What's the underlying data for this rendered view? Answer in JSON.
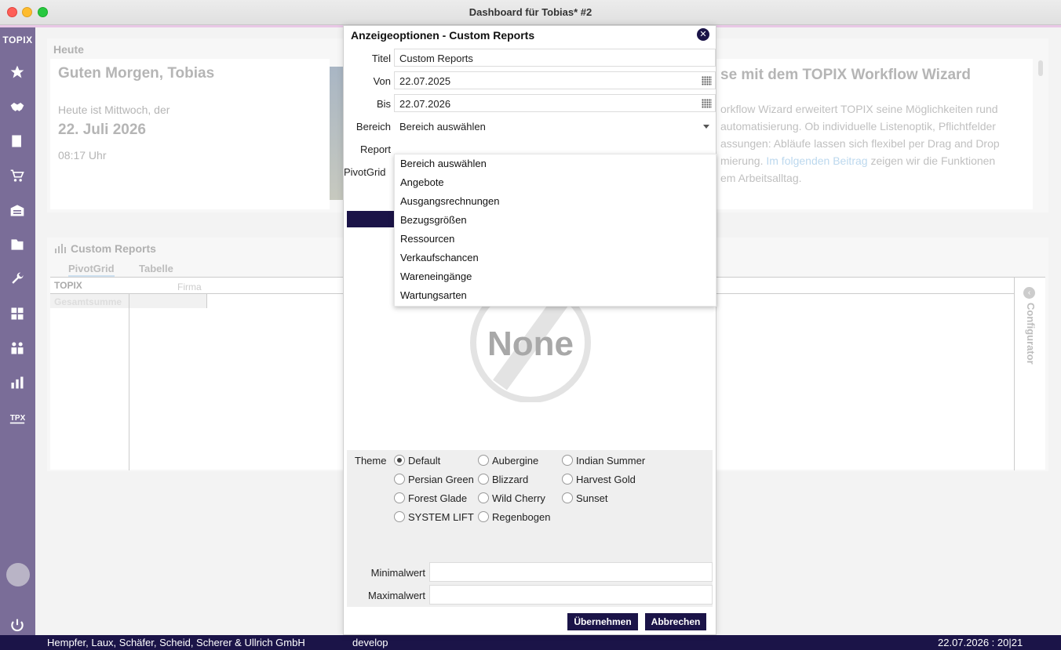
{
  "window": {
    "title": "Dashboard für Tobias* #2"
  },
  "sidebar": {
    "logo": "TOPIX",
    "items": [
      "favorites-icon",
      "handshake-icon",
      "invoice-icon",
      "cart-icon",
      "warehouse-icon",
      "archive-icon",
      "wrench-icon",
      "calculator-icon",
      "people-icon",
      "chart-icon",
      "tpx-icon"
    ],
    "power": "power-icon"
  },
  "heute": {
    "label": "Heute",
    "greeting": "Guten Morgen, Tobias",
    "today_text": "Heute ist Mittwoch, der",
    "date": "22. Juli 2026",
    "time": "08:17 Uhr"
  },
  "news": {
    "title": "se mit dem TOPIX Workflow Wizard",
    "lines": [
      "orkflow Wizard erweitert TOPIX seine Möglichkeiten rund",
      "automatisierung. Ob individuelle Listenoptik, Pflichtfelder",
      "assungen: Abläufe lassen sich flexibel per Drag and Drop",
      "mierung.",
      "em Arbeitsalltag."
    ],
    "link_text": "Im folgenden Beitrag",
    "after_link": "zeigen wir die Funktionen"
  },
  "reports": {
    "title": "Custom Reports",
    "tabs": [
      "PivotGrid",
      "Tabelle"
    ],
    "grid_head": "TOPIX",
    "grid_firma": "Firma",
    "grid_sum": "Gesamtsumme",
    "configurator": "Configurator"
  },
  "dialog": {
    "title": "Anzeigeoptionen - Custom Reports",
    "fields": {
      "titel_label": "Titel",
      "titel_value": "Custom Reports",
      "von_label": "Von",
      "von_value": "22.07.2025",
      "bis_label": "Bis",
      "bis_value": "22.07.2026",
      "bereich_label": "Bereich",
      "bereich_value": "Bereich auswählen",
      "report_label": "Report",
      "pivot_label": "PivotGrid"
    },
    "dropdown_options": [
      "Bereich auswählen",
      "Angebote",
      "Ausgangsrechnungen",
      "Bezugsgrößen",
      "Ressourcen",
      "Verkaufschancen",
      "Wareneingänge",
      "Wartungsarten"
    ],
    "preview_text": "None",
    "theme_label": "Theme",
    "themes": [
      {
        "name": "Default",
        "checked": true
      },
      {
        "name": "Aubergine",
        "checked": false
      },
      {
        "name": "Indian Summer",
        "checked": false
      },
      {
        "name": "Persian Green",
        "checked": false
      },
      {
        "name": "Blizzard",
        "checked": false
      },
      {
        "name": "Harvest Gold",
        "checked": false
      },
      {
        "name": "Forest Glade",
        "checked": false
      },
      {
        "name": "Wild Cherry",
        "checked": false
      },
      {
        "name": "Sunset",
        "checked": false
      },
      {
        "name": "SYSTEM LIFT",
        "checked": false
      },
      {
        "name": "Regenbogen",
        "checked": false
      }
    ],
    "min_label": "Minimalwert",
    "max_label": "Maximalwert",
    "apply_label": "Übernehmen",
    "cancel_label": "Abbrechen"
  },
  "status": {
    "company": "Hempfer, Laux, Schäfer, Scheid, Scherer & Ullrich GmbH",
    "branch": "develop",
    "datetime": "22.07.2026 : 20|21"
  },
  "colors": {
    "brand_dark": "#1b1448",
    "sidebar": "#7a6d98",
    "accent_pink": "#e9c8e6"
  }
}
